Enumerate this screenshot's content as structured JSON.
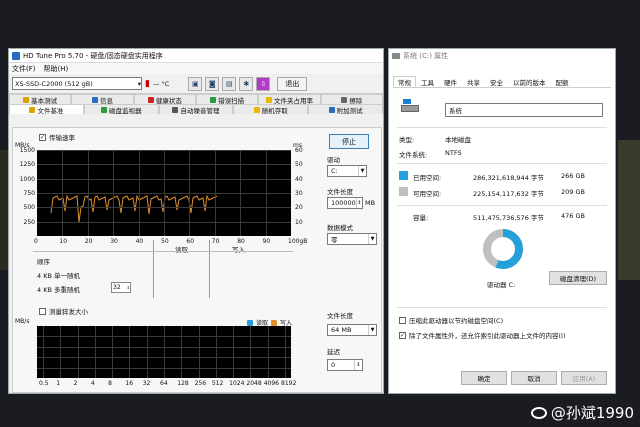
{
  "hdtune": {
    "title": "HD Tune Pro 5.70 - 硬盘/固态硬盘实用程序",
    "menu": [
      "文件(F)",
      "帮助(H)"
    ],
    "drive": "XS-SSD-C2000 (512 gB)",
    "temp_value": "— °C",
    "exit_label": "退出",
    "tabs_top": [
      "基本测试",
      "信息",
      "健康状态",
      "错误扫描",
      "文件夹占用率",
      "擦除"
    ],
    "tabs_bottom": [
      "文件基准",
      "磁盘监视器",
      "自动噪音管理",
      "随机存取",
      "附加测试"
    ],
    "transfer_checkbox": "传输速率",
    "chart1": {
      "unit_left": "MB/s",
      "unit_right": "ms",
      "yticks_left": [
        "1500",
        "1250",
        "1000",
        "750",
        "500",
        "250"
      ],
      "yticks_right": [
        "60",
        "50",
        "40",
        "30",
        "20",
        "10"
      ],
      "xticks": [
        "0",
        "10",
        "20",
        "30",
        "40",
        "50",
        "60",
        "70",
        "80",
        "90",
        "100gB"
      ]
    },
    "table": {
      "col_read": "读取",
      "col_write": "写入",
      "row_header": "顺序",
      "rows": [
        "4 KB 单一随机",
        "4 KB 多重随机"
      ],
      "qd_value": "32"
    },
    "burst_checkbox": "测量猝发大小",
    "chart2": {
      "unit": "MB/s",
      "legend_read": "读取",
      "legend_write": "写入",
      "xticks": [
        "0.5",
        "1",
        "2",
        "4",
        "8",
        "16",
        "32",
        "64",
        "128",
        "256",
        "512",
        "1024",
        "2048",
        "4096",
        "8192"
      ]
    },
    "right_panel": {
      "stop_label": "停止",
      "drive_label": "驱动",
      "drive_value": "C:",
      "file_length_label": "文件长度",
      "file_length_value": "100000",
      "file_length_unit": "MB",
      "data_mode_label": "数据模式",
      "data_mode_value": "零",
      "file_length2_label": "文件长度",
      "file_length2_value": "64 MB",
      "delay_label": "延迟",
      "delay_value": "0"
    }
  },
  "props": {
    "title": "系统 (C:) 属性",
    "tabs": [
      "常规",
      "工具",
      "硬件",
      "共享",
      "安全",
      "以前的版本",
      "配额"
    ],
    "volume_name": "系统",
    "type_label": "类型:",
    "type_value": "本地磁盘",
    "fs_label": "文件系统:",
    "fs_value": "NTFS",
    "used_label": "已用空间:",
    "used_bytes": "286,321,618,944 字节",
    "used_gb": "266 GB",
    "free_label": "可用空间:",
    "free_bytes": "225,154,117,632 字节",
    "free_gb": "209 GB",
    "capacity_label": "容量:",
    "capacity_bytes": "511,475,736,576 字节",
    "capacity_gb": "476 GB",
    "drive_label": "驱动器 C:",
    "cleanup_label": "磁盘清理(D)",
    "compress_label": "压缩此驱动器以节约磁盘空间(C)",
    "index_label": "除了文件属性外，还允许索引此驱动器上文件的内容(I)",
    "ok_label": "确定",
    "cancel_label": "取消",
    "apply_label": "应用(A)",
    "used_fraction": 0.56,
    "colors": {
      "used": "#26a0da",
      "free": "#bfbfbf"
    }
  },
  "watermark": "@孙斌1990"
}
